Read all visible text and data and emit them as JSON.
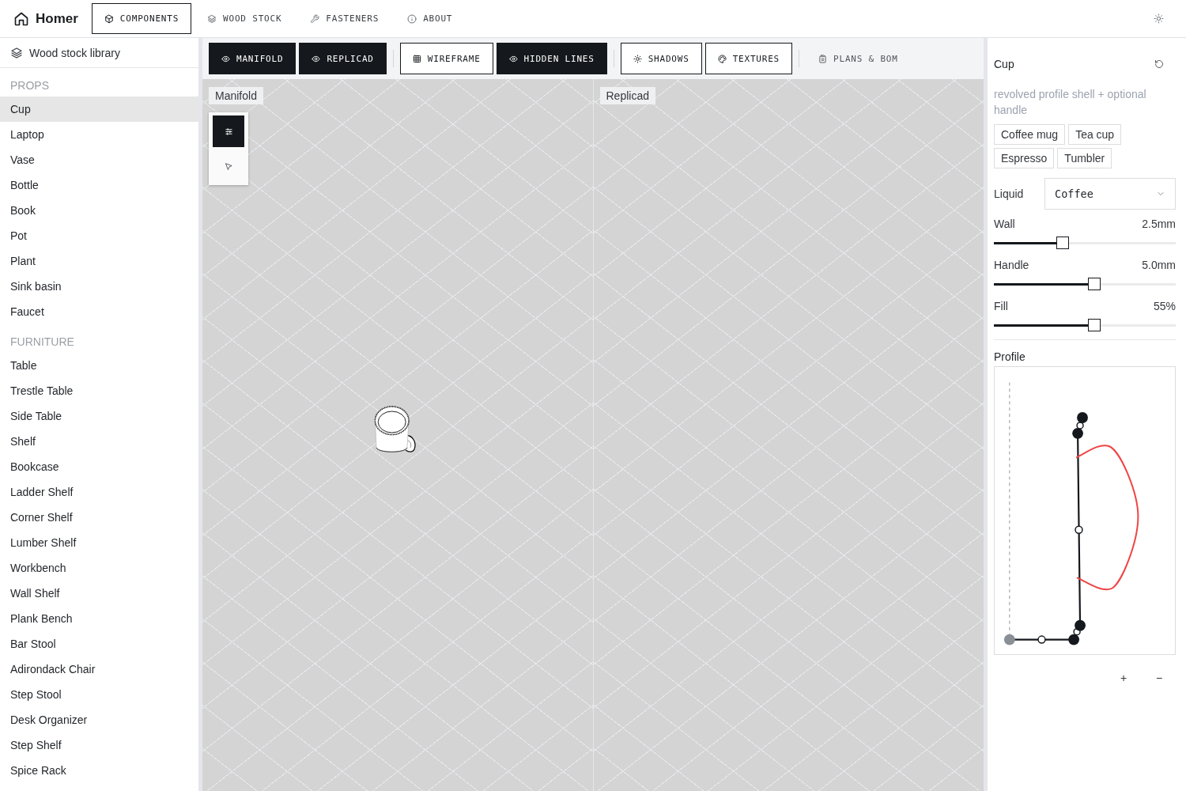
{
  "brand": {
    "title": "Homer"
  },
  "nav_tabs": [
    {
      "label": "COMPONENTS",
      "selected": true
    },
    {
      "label": "WOOD STOCK",
      "selected": false
    },
    {
      "label": "FASTENERS",
      "selected": false
    },
    {
      "label": "ABOUT",
      "selected": false
    }
  ],
  "sidebar": {
    "title": "Wood stock library",
    "sections": [
      {
        "heading": "PROPS",
        "items": [
          {
            "label": "Cup",
            "selected": true
          },
          {
            "label": "Laptop",
            "selected": false
          },
          {
            "label": "Vase",
            "selected": false
          },
          {
            "label": "Bottle",
            "selected": false
          },
          {
            "label": "Book",
            "selected": false
          },
          {
            "label": "Pot",
            "selected": false
          },
          {
            "label": "Plant",
            "selected": false
          },
          {
            "label": "Sink basin",
            "selected": false
          },
          {
            "label": "Faucet",
            "selected": false
          }
        ]
      },
      {
        "heading": "FURNITURE",
        "items": [
          {
            "label": "Table",
            "selected": false
          },
          {
            "label": "Trestle Table",
            "selected": false
          },
          {
            "label": "Side Table",
            "selected": false
          },
          {
            "label": "Shelf",
            "selected": false
          },
          {
            "label": "Bookcase",
            "selected": false
          },
          {
            "label": "Ladder Shelf",
            "selected": false
          },
          {
            "label": "Corner Shelf",
            "selected": false
          },
          {
            "label": "Lumber Shelf",
            "selected": false
          },
          {
            "label": "Workbench",
            "selected": false
          },
          {
            "label": "Wall Shelf",
            "selected": false
          },
          {
            "label": "Plank Bench",
            "selected": false
          },
          {
            "label": "Bar Stool",
            "selected": false
          },
          {
            "label": "Adirondack Chair",
            "selected": false
          },
          {
            "label": "Step Stool",
            "selected": false
          },
          {
            "label": "Desk Organizer",
            "selected": false
          },
          {
            "label": "Step Shelf",
            "selected": false
          },
          {
            "label": "Spice Rack",
            "selected": false
          }
        ]
      }
    ]
  },
  "toolbar": {
    "groups": [
      {
        "buttons": [
          {
            "kind": "toggle",
            "label": "MANIFOLD",
            "on": true
          },
          {
            "kind": "toggle",
            "label": "REPLICAD",
            "on": true
          }
        ]
      },
      {
        "buttons": [
          {
            "kind": "toggle",
            "label": "WIREFRAME",
            "on": false
          },
          {
            "kind": "toggle",
            "label": "HIDDEN LINES",
            "on": true
          }
        ]
      },
      {
        "buttons": [
          {
            "kind": "toggle",
            "label": "SHADOWS",
            "on": false
          },
          {
            "kind": "toggle",
            "label": "TEXTURES",
            "on": false
          }
        ]
      },
      {
        "buttons": [
          {
            "kind": "action",
            "label": "PLANS & BOM"
          }
        ]
      }
    ]
  },
  "viewports": [
    {
      "label": "Manifold",
      "show_model": true,
      "tools": [
        {
          "selected": true
        },
        {
          "selected": false
        }
      ]
    },
    {
      "label": "Replicad",
      "show_model": false
    }
  ],
  "inspector": {
    "title": "Cup",
    "description": "revolved profile shell + optional handle",
    "presets": [
      "Coffee mug",
      "Tea cup",
      "Espresso",
      "Tumbler"
    ],
    "liquid": {
      "label": "Liquid",
      "value": "Coffee"
    },
    "sliders": [
      {
        "label": "Wall",
        "reading": "2.5mm",
        "level": 0.38
      },
      {
        "label": "Handle",
        "reading": "5.0mm",
        "level": 0.55
      },
      {
        "label": "Fill",
        "reading": "55%",
        "level": 0.55
      }
    ],
    "profile": {
      "label": "Profile"
    },
    "profile_buttons": [
      "+",
      "−"
    ]
  }
}
